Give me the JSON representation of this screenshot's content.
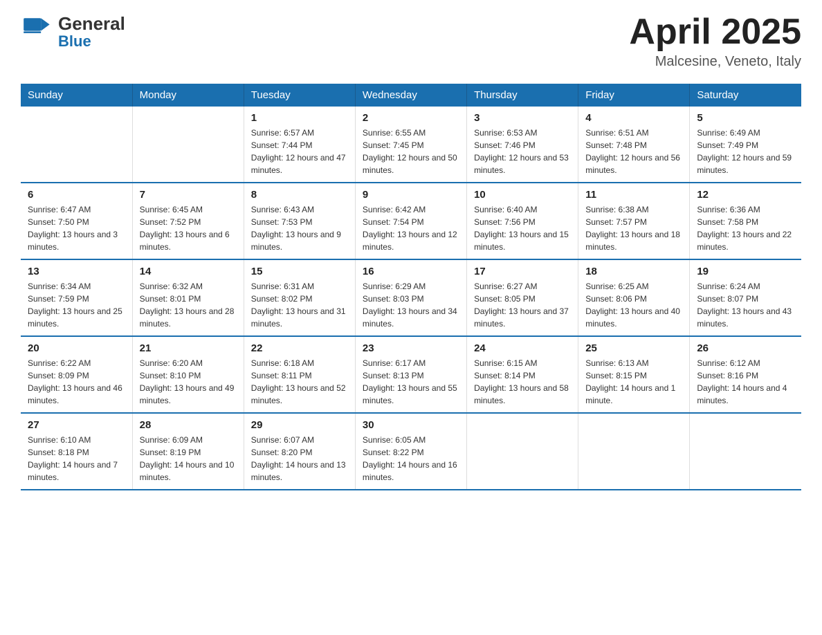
{
  "header": {
    "logo_general": "General",
    "logo_blue": "Blue",
    "month_year": "April 2025",
    "location": "Malcesine, Veneto, Italy"
  },
  "days_of_week": [
    "Sunday",
    "Monday",
    "Tuesday",
    "Wednesday",
    "Thursday",
    "Friday",
    "Saturday"
  ],
  "weeks": [
    [
      {
        "day": "",
        "sunrise": "",
        "sunset": "",
        "daylight": ""
      },
      {
        "day": "",
        "sunrise": "",
        "sunset": "",
        "daylight": ""
      },
      {
        "day": "1",
        "sunrise": "Sunrise: 6:57 AM",
        "sunset": "Sunset: 7:44 PM",
        "daylight": "Daylight: 12 hours and 47 minutes."
      },
      {
        "day": "2",
        "sunrise": "Sunrise: 6:55 AM",
        "sunset": "Sunset: 7:45 PM",
        "daylight": "Daylight: 12 hours and 50 minutes."
      },
      {
        "day": "3",
        "sunrise": "Sunrise: 6:53 AM",
        "sunset": "Sunset: 7:46 PM",
        "daylight": "Daylight: 12 hours and 53 minutes."
      },
      {
        "day": "4",
        "sunrise": "Sunrise: 6:51 AM",
        "sunset": "Sunset: 7:48 PM",
        "daylight": "Daylight: 12 hours and 56 minutes."
      },
      {
        "day": "5",
        "sunrise": "Sunrise: 6:49 AM",
        "sunset": "Sunset: 7:49 PM",
        "daylight": "Daylight: 12 hours and 59 minutes."
      }
    ],
    [
      {
        "day": "6",
        "sunrise": "Sunrise: 6:47 AM",
        "sunset": "Sunset: 7:50 PM",
        "daylight": "Daylight: 13 hours and 3 minutes."
      },
      {
        "day": "7",
        "sunrise": "Sunrise: 6:45 AM",
        "sunset": "Sunset: 7:52 PM",
        "daylight": "Daylight: 13 hours and 6 minutes."
      },
      {
        "day": "8",
        "sunrise": "Sunrise: 6:43 AM",
        "sunset": "Sunset: 7:53 PM",
        "daylight": "Daylight: 13 hours and 9 minutes."
      },
      {
        "day": "9",
        "sunrise": "Sunrise: 6:42 AM",
        "sunset": "Sunset: 7:54 PM",
        "daylight": "Daylight: 13 hours and 12 minutes."
      },
      {
        "day": "10",
        "sunrise": "Sunrise: 6:40 AM",
        "sunset": "Sunset: 7:56 PM",
        "daylight": "Daylight: 13 hours and 15 minutes."
      },
      {
        "day": "11",
        "sunrise": "Sunrise: 6:38 AM",
        "sunset": "Sunset: 7:57 PM",
        "daylight": "Daylight: 13 hours and 18 minutes."
      },
      {
        "day": "12",
        "sunrise": "Sunrise: 6:36 AM",
        "sunset": "Sunset: 7:58 PM",
        "daylight": "Daylight: 13 hours and 22 minutes."
      }
    ],
    [
      {
        "day": "13",
        "sunrise": "Sunrise: 6:34 AM",
        "sunset": "Sunset: 7:59 PM",
        "daylight": "Daylight: 13 hours and 25 minutes."
      },
      {
        "day": "14",
        "sunrise": "Sunrise: 6:32 AM",
        "sunset": "Sunset: 8:01 PM",
        "daylight": "Daylight: 13 hours and 28 minutes."
      },
      {
        "day": "15",
        "sunrise": "Sunrise: 6:31 AM",
        "sunset": "Sunset: 8:02 PM",
        "daylight": "Daylight: 13 hours and 31 minutes."
      },
      {
        "day": "16",
        "sunrise": "Sunrise: 6:29 AM",
        "sunset": "Sunset: 8:03 PM",
        "daylight": "Daylight: 13 hours and 34 minutes."
      },
      {
        "day": "17",
        "sunrise": "Sunrise: 6:27 AM",
        "sunset": "Sunset: 8:05 PM",
        "daylight": "Daylight: 13 hours and 37 minutes."
      },
      {
        "day": "18",
        "sunrise": "Sunrise: 6:25 AM",
        "sunset": "Sunset: 8:06 PM",
        "daylight": "Daylight: 13 hours and 40 minutes."
      },
      {
        "day": "19",
        "sunrise": "Sunrise: 6:24 AM",
        "sunset": "Sunset: 8:07 PM",
        "daylight": "Daylight: 13 hours and 43 minutes."
      }
    ],
    [
      {
        "day": "20",
        "sunrise": "Sunrise: 6:22 AM",
        "sunset": "Sunset: 8:09 PM",
        "daylight": "Daylight: 13 hours and 46 minutes."
      },
      {
        "day": "21",
        "sunrise": "Sunrise: 6:20 AM",
        "sunset": "Sunset: 8:10 PM",
        "daylight": "Daylight: 13 hours and 49 minutes."
      },
      {
        "day": "22",
        "sunrise": "Sunrise: 6:18 AM",
        "sunset": "Sunset: 8:11 PM",
        "daylight": "Daylight: 13 hours and 52 minutes."
      },
      {
        "day": "23",
        "sunrise": "Sunrise: 6:17 AM",
        "sunset": "Sunset: 8:13 PM",
        "daylight": "Daylight: 13 hours and 55 minutes."
      },
      {
        "day": "24",
        "sunrise": "Sunrise: 6:15 AM",
        "sunset": "Sunset: 8:14 PM",
        "daylight": "Daylight: 13 hours and 58 minutes."
      },
      {
        "day": "25",
        "sunrise": "Sunrise: 6:13 AM",
        "sunset": "Sunset: 8:15 PM",
        "daylight": "Daylight: 14 hours and 1 minute."
      },
      {
        "day": "26",
        "sunrise": "Sunrise: 6:12 AM",
        "sunset": "Sunset: 8:16 PM",
        "daylight": "Daylight: 14 hours and 4 minutes."
      }
    ],
    [
      {
        "day": "27",
        "sunrise": "Sunrise: 6:10 AM",
        "sunset": "Sunset: 8:18 PM",
        "daylight": "Daylight: 14 hours and 7 minutes."
      },
      {
        "day": "28",
        "sunrise": "Sunrise: 6:09 AM",
        "sunset": "Sunset: 8:19 PM",
        "daylight": "Daylight: 14 hours and 10 minutes."
      },
      {
        "day": "29",
        "sunrise": "Sunrise: 6:07 AM",
        "sunset": "Sunset: 8:20 PM",
        "daylight": "Daylight: 14 hours and 13 minutes."
      },
      {
        "day": "30",
        "sunrise": "Sunrise: 6:05 AM",
        "sunset": "Sunset: 8:22 PM",
        "daylight": "Daylight: 14 hours and 16 minutes."
      },
      {
        "day": "",
        "sunrise": "",
        "sunset": "",
        "daylight": ""
      },
      {
        "day": "",
        "sunrise": "",
        "sunset": "",
        "daylight": ""
      },
      {
        "day": "",
        "sunrise": "",
        "sunset": "",
        "daylight": ""
      }
    ]
  ]
}
